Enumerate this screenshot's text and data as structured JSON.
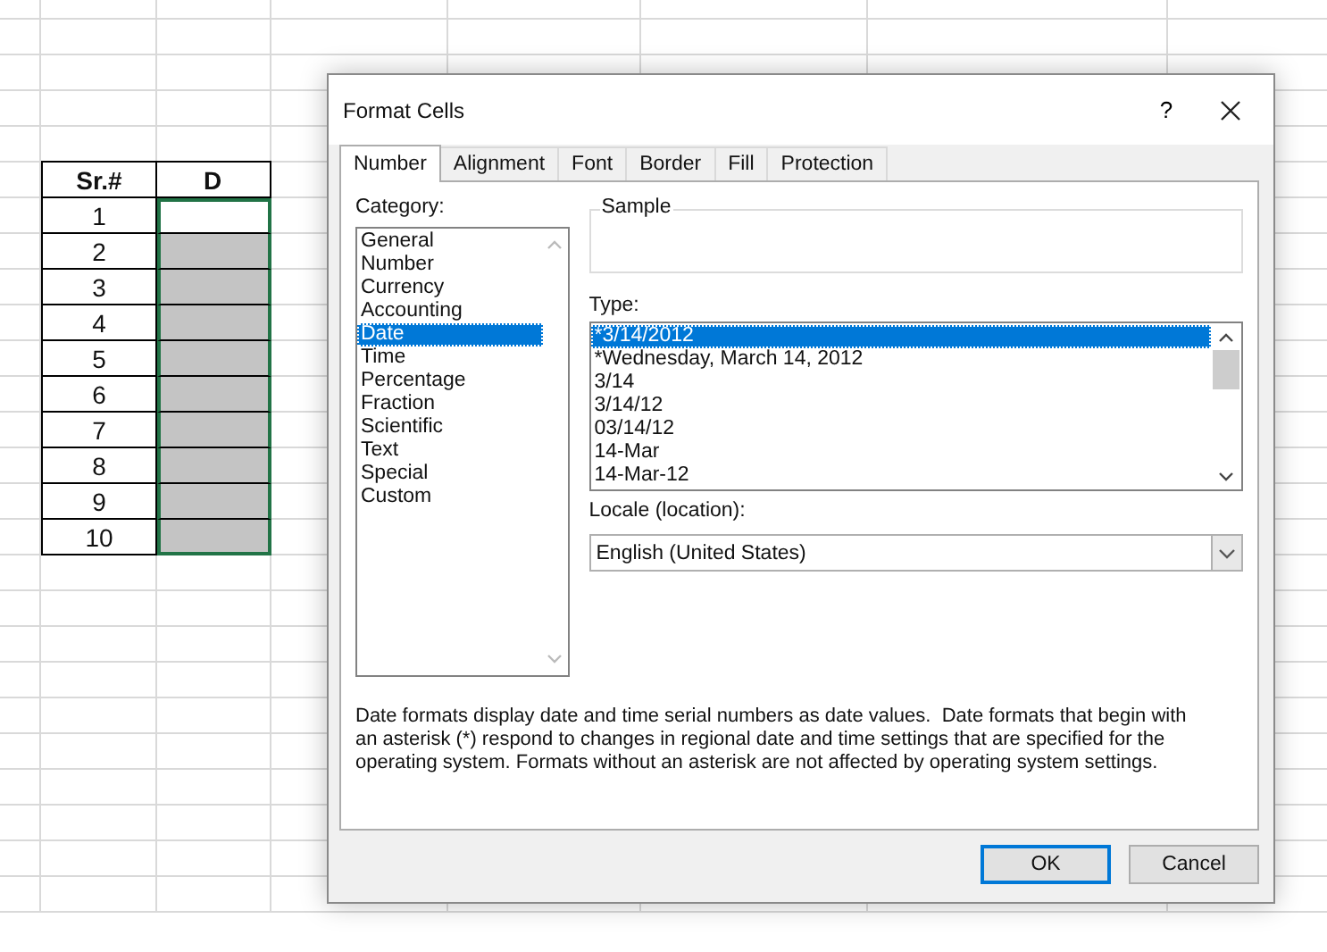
{
  "sheet": {
    "headers": [
      "Sr.#",
      "D"
    ],
    "rows": [
      {
        "sr": "1",
        "filled": false
      },
      {
        "sr": "2",
        "filled": true
      },
      {
        "sr": "3",
        "filled": true
      },
      {
        "sr": "4",
        "filled": true
      },
      {
        "sr": "5",
        "filled": true
      },
      {
        "sr": "6",
        "filled": true
      },
      {
        "sr": "7",
        "filled": true
      },
      {
        "sr": "8",
        "filled": true
      },
      {
        "sr": "9",
        "filled": true
      },
      {
        "sr": "10",
        "filled": true
      }
    ]
  },
  "dialog": {
    "title": "Format Cells",
    "help": "?",
    "tabs": [
      {
        "label": "Number",
        "selected": true
      },
      {
        "label": "Alignment",
        "selected": false
      },
      {
        "label": "Font",
        "selected": false
      },
      {
        "label": "Border",
        "selected": false
      },
      {
        "label": "Fill",
        "selected": false
      },
      {
        "label": "Protection",
        "selected": false
      }
    ],
    "category": {
      "label": "Category:",
      "items": [
        {
          "label": "General",
          "selected": false
        },
        {
          "label": "Number",
          "selected": false
        },
        {
          "label": "Currency",
          "selected": false
        },
        {
          "label": "Accounting",
          "selected": false
        },
        {
          "label": "Date",
          "selected": true
        },
        {
          "label": "Time",
          "selected": false
        },
        {
          "label": "Percentage",
          "selected": false
        },
        {
          "label": "Fraction",
          "selected": false
        },
        {
          "label": "Scientific",
          "selected": false
        },
        {
          "label": "Text",
          "selected": false
        },
        {
          "label": "Special",
          "selected": false
        },
        {
          "label": "Custom",
          "selected": false
        }
      ]
    },
    "sample": {
      "label": "Sample"
    },
    "type": {
      "label": "Type:",
      "items": [
        {
          "label": "*3/14/2012",
          "selected": true
        },
        {
          "label": "*Wednesday, March 14, 2012",
          "selected": false
        },
        {
          "label": "3/14",
          "selected": false
        },
        {
          "label": "3/14/12",
          "selected": false
        },
        {
          "label": "03/14/12",
          "selected": false
        },
        {
          "label": "14-Mar",
          "selected": false
        },
        {
          "label": "14-Mar-12",
          "selected": false
        }
      ]
    },
    "locale": {
      "label": "Locale (location):",
      "value": "English (United States)"
    },
    "description": "Date formats display date and time serial numbers as date values.  Date formats that begin with an asterisk (*) respond to changes in regional date and time settings that are specified for the operating system. Formats without an asterisk are not affected by operating system settings.",
    "buttons": [
      {
        "label": "OK",
        "default": true
      },
      {
        "label": "Cancel",
        "default": false
      }
    ]
  }
}
